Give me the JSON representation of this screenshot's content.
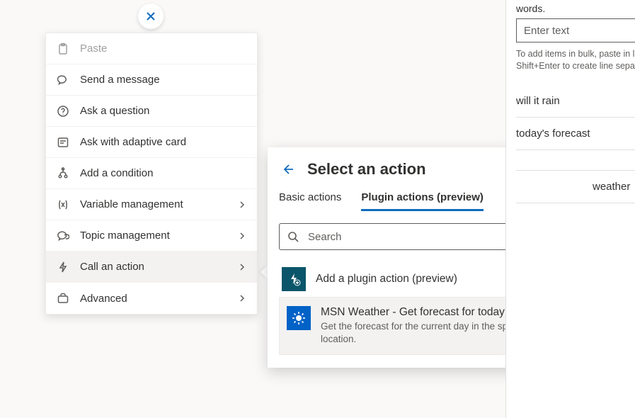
{
  "contextMenu": {
    "paste": "Paste",
    "sendMessage": "Send a message",
    "askQuestion": "Ask a question",
    "askAdaptive": "Ask with adaptive card",
    "addCondition": "Add a condition",
    "variableMgmt": "Variable management",
    "topicMgmt": "Topic management",
    "callAction": "Call an action",
    "advanced": "Advanced"
  },
  "actionPanel": {
    "title": "Select an action",
    "tabs": {
      "basic": "Basic actions",
      "plugin": "Plugin actions (preview)"
    },
    "searchPlaceholder": "Search",
    "addPlugin": "Add a plugin action (preview)",
    "items": [
      {
        "title": "MSN Weather - Get forecast for today",
        "desc": "Get the forecast for the current day in the specified location."
      }
    ]
  },
  "sidePanel": {
    "prefixLine": "words.",
    "enterPlaceholder": "Enter text",
    "hintLine1": "To add items in bulk, paste in li",
    "hintLine2": "Shift+Enter to create line separ",
    "phrases": {
      "p1": "will it rain",
      "p2": "today's forecast",
      "p3": "weather"
    }
  }
}
